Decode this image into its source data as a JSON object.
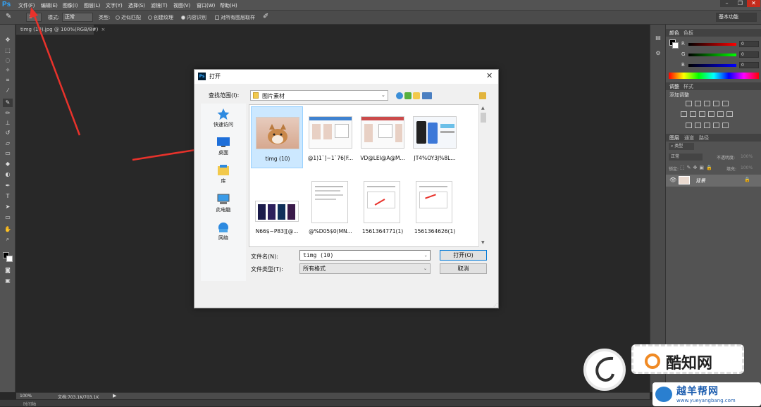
{
  "app": {
    "logo": "Ps"
  },
  "menubar": {
    "items": [
      "文件(F)",
      "编辑(E)",
      "图像(I)",
      "图层(L)",
      "文字(Y)",
      "选择(S)",
      "滤镜(T)",
      "视图(V)",
      "窗口(W)",
      "帮助(H)"
    ],
    "window_controls": [
      "–",
      "❐",
      "✕"
    ]
  },
  "options": {
    "brush_size": "2",
    "mode_label": "模式:",
    "mode_value": "正常",
    "type_label": "类型:",
    "type_options": [
      "近似匹配",
      "创建纹理",
      "内容识别"
    ],
    "type_selected": 2,
    "sample_all_label": "对所有图层取样",
    "workspace": "基本功能"
  },
  "document": {
    "tab_title": "timg (10).jpg @ 100%(RGB/8#)"
  },
  "status": {
    "zoom": "100%",
    "doc_info": "文档:703.1K/703.1K"
  },
  "timeline": {
    "label": "时间轴"
  },
  "right_panel": {
    "color_tabs": [
      "颜色",
      "色板"
    ],
    "color_sliders": [
      {
        "label": "R",
        "value": "0",
        "gradient": "#ff0000"
      },
      {
        "label": "G",
        "value": "0",
        "gradient": "#00ff00"
      },
      {
        "label": "B",
        "value": "0",
        "gradient": "#0000ff"
      }
    ],
    "adjust_tabs": [
      "调整",
      "样式"
    ],
    "adjust_title": "添加调整",
    "layer_tabs": [
      "图层",
      "通道",
      "路径"
    ],
    "layer_filter": "类型",
    "blend_mode": "正常",
    "opacity_label": "不透明度:",
    "opacity_value": "100%",
    "lock_label": "锁定:",
    "fill_label": "填充:",
    "fill_value": "100%",
    "layers": [
      {
        "name": "背景"
      }
    ]
  },
  "dialog": {
    "title": "打开",
    "title_icon": "Ps",
    "lookin_label": "查找范围(I):",
    "lookin_value": "图片素材",
    "places": [
      {
        "label": "快速访问",
        "icon": "star-icon"
      },
      {
        "label": "桌面",
        "icon": "desktop-icon"
      },
      {
        "label": "库",
        "icon": "library-icon"
      },
      {
        "label": "此电脑",
        "icon": "computer-icon"
      },
      {
        "label": "网络",
        "icon": "network-icon"
      }
    ],
    "files": [
      {
        "name": "timg (10)",
        "selected": true
      },
      {
        "name": "@1)1`]~1`76[F..."
      },
      {
        "name": "VD@LEI@A@M..."
      },
      {
        "name": "JT4%OY3J%8L..."
      },
      {
        "name": "N66$~P83][@..."
      },
      {
        "name": "@%D05$0(MN..."
      },
      {
        "name": "1561364771(1)"
      },
      {
        "name": "1561364626(1)"
      }
    ],
    "filename_label": "文件名(N):",
    "filename_value": "timg (10)",
    "filetype_label": "文件类型(T):",
    "filetype_value": "所有格式",
    "open_button": "打开(O)",
    "cancel_button": "取消"
  },
  "watermark": {
    "brand": "酷知网",
    "site_name": "越羊帮网",
    "site_url": "www.yueyangbang.com"
  }
}
